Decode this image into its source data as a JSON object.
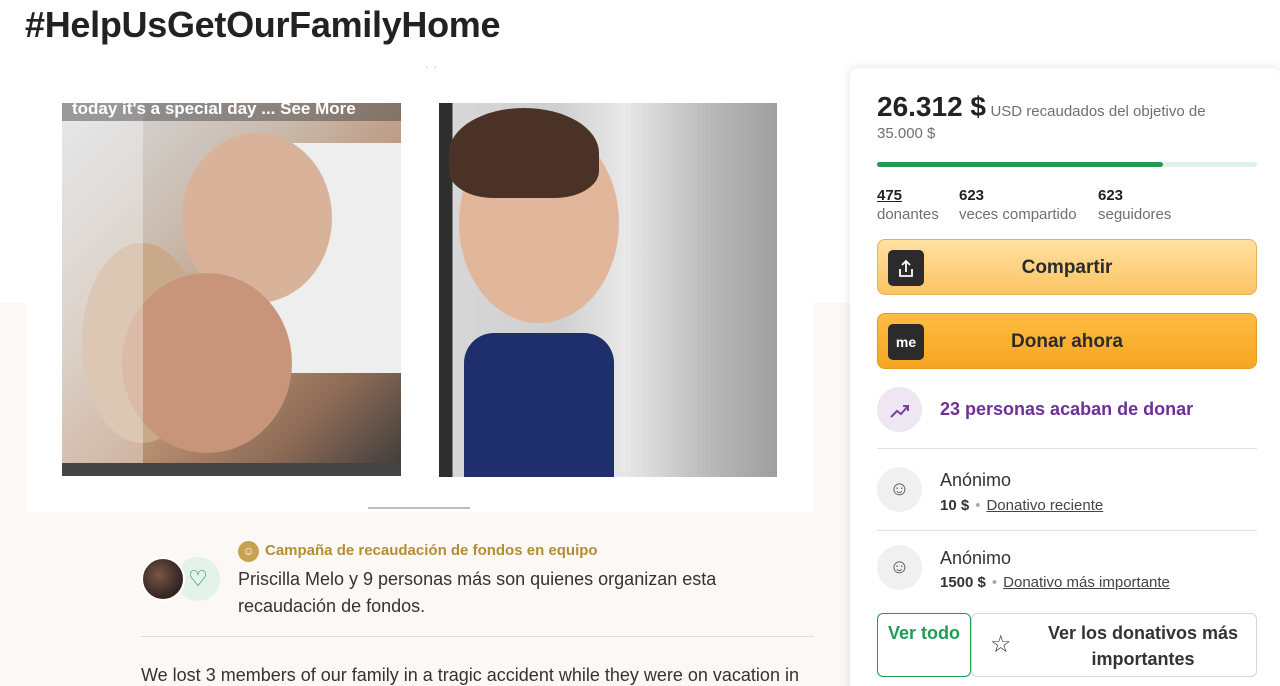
{
  "campaign": {
    "title": "#HelpUsGetOurFamilyHome"
  },
  "gallery": {
    "top_text": "· ·",
    "left_photo_caption": "today it's a special day ... See More"
  },
  "organizer": {
    "team_label": "Campaña de recaudación de fondos en equipo",
    "description": "Priscilla Melo y 9 personas más son quienes organizan esta recaudación de fondos.",
    "avatar_icon": "user-heart-icon"
  },
  "story": {
    "text": "We lost 3 members of our family in a tragic accident while they were on vacation in"
  },
  "donation": {
    "raised": "26.312 $",
    "raised_suffix": "USD recaudados del objetivo de",
    "goal": "35.000 $",
    "progress_fraction": 0.752,
    "colors": {
      "progress": "#1f9d55",
      "progress_track": "#dff2ea",
      "recent_accent": "#6f2f97"
    },
    "stats": [
      {
        "value": "475",
        "label": "donantes"
      },
      {
        "value": "623",
        "label": "veces compartido"
      },
      {
        "value": "623",
        "label": "seguidores"
      }
    ],
    "share_button": "Compartir",
    "donate_button": "Donar ahora",
    "donate_icon_text": "me",
    "recent_donations_label": "23 personas acaban de donar",
    "donors": [
      {
        "name": "Anónimo",
        "amount": "10 $",
        "tag": "Donativo reciente"
      },
      {
        "name": "Anónimo",
        "amount": "1500 $",
        "tag": "Donativo más importante"
      }
    ],
    "see_all_button": "Ver todo",
    "top_donations_button": "Ver los donativos más importantes"
  }
}
